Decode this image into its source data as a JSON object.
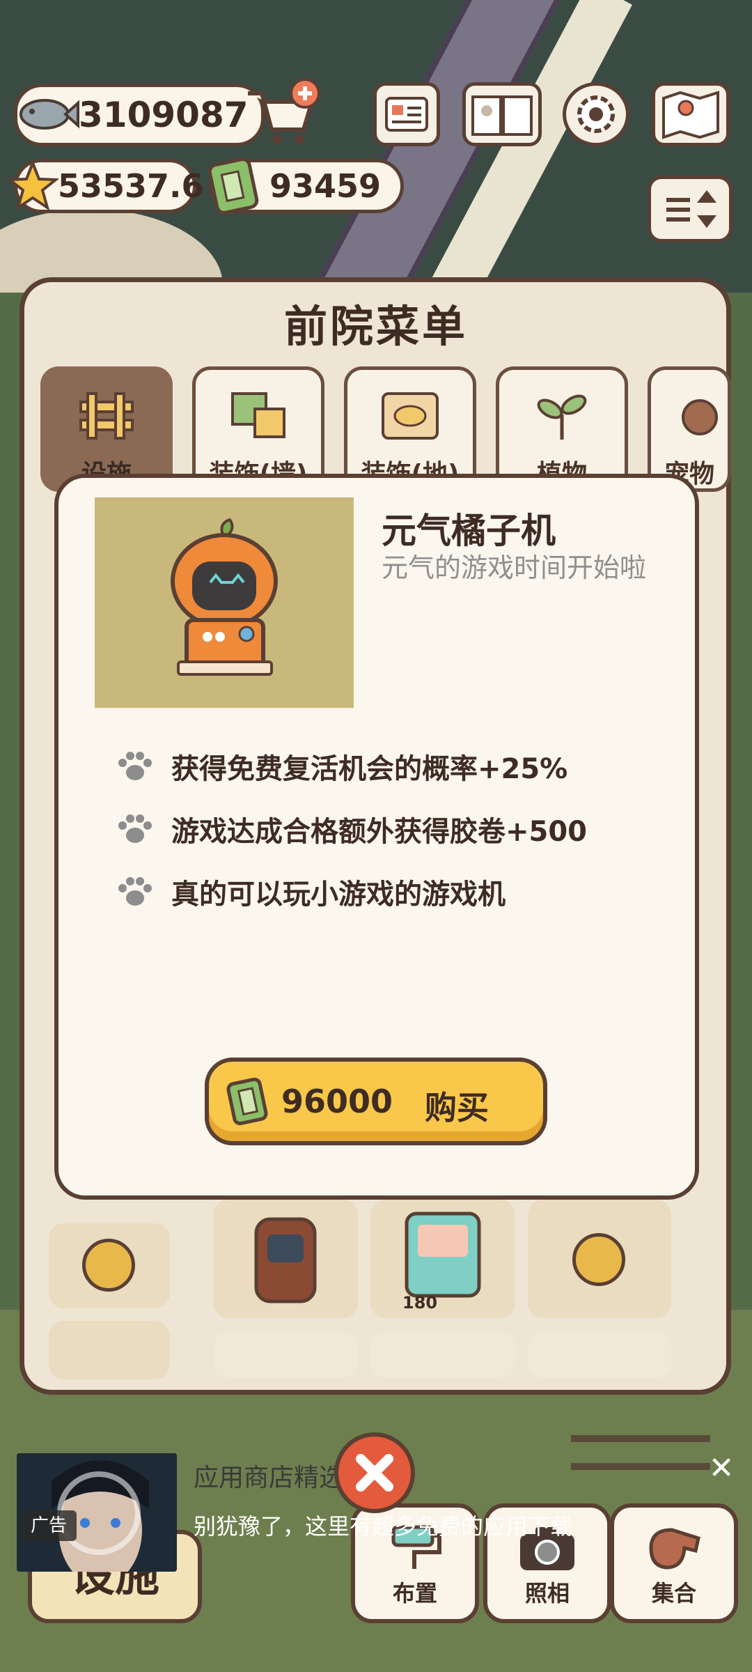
{
  "hud": {
    "fish_count": "3109087",
    "star_count": "53537.6",
    "ticket_count": "93459"
  },
  "panel": {
    "title": "前院菜单",
    "tabs": [
      {
        "label": "设施"
      },
      {
        "label": "装饰(墙)"
      },
      {
        "label": "装饰(地)"
      },
      {
        "label": "植物"
      },
      {
        "label": "宠物"
      }
    ],
    "grid_price": "180"
  },
  "modal": {
    "item_name": "元气橘子机",
    "item_desc": "元气的游戏时间开始啦",
    "perks": [
      "获得免费复活机会的概率+25%",
      "游戏达成合格额外获得胶卷+500",
      "真的可以玩小游戏的游戏机"
    ],
    "buy_price": "96000",
    "buy_label": "购买"
  },
  "bottom": {
    "facility_label": "设施",
    "arrange_label": "布置",
    "photo_label": "照相",
    "gather_label": "集合"
  },
  "ad": {
    "badge": "广告",
    "title": "应用商店精选",
    "text": "别犹豫了，这里有超多免费的应用下载"
  },
  "colors": {
    "outline": "#5a3f33",
    "panel_bg": "#eee5d5",
    "modal_bg": "#fbf6ee",
    "buy_button": "#f9c84b",
    "preview_bg": "#c9b87c",
    "close_red": "#e35b3c"
  }
}
